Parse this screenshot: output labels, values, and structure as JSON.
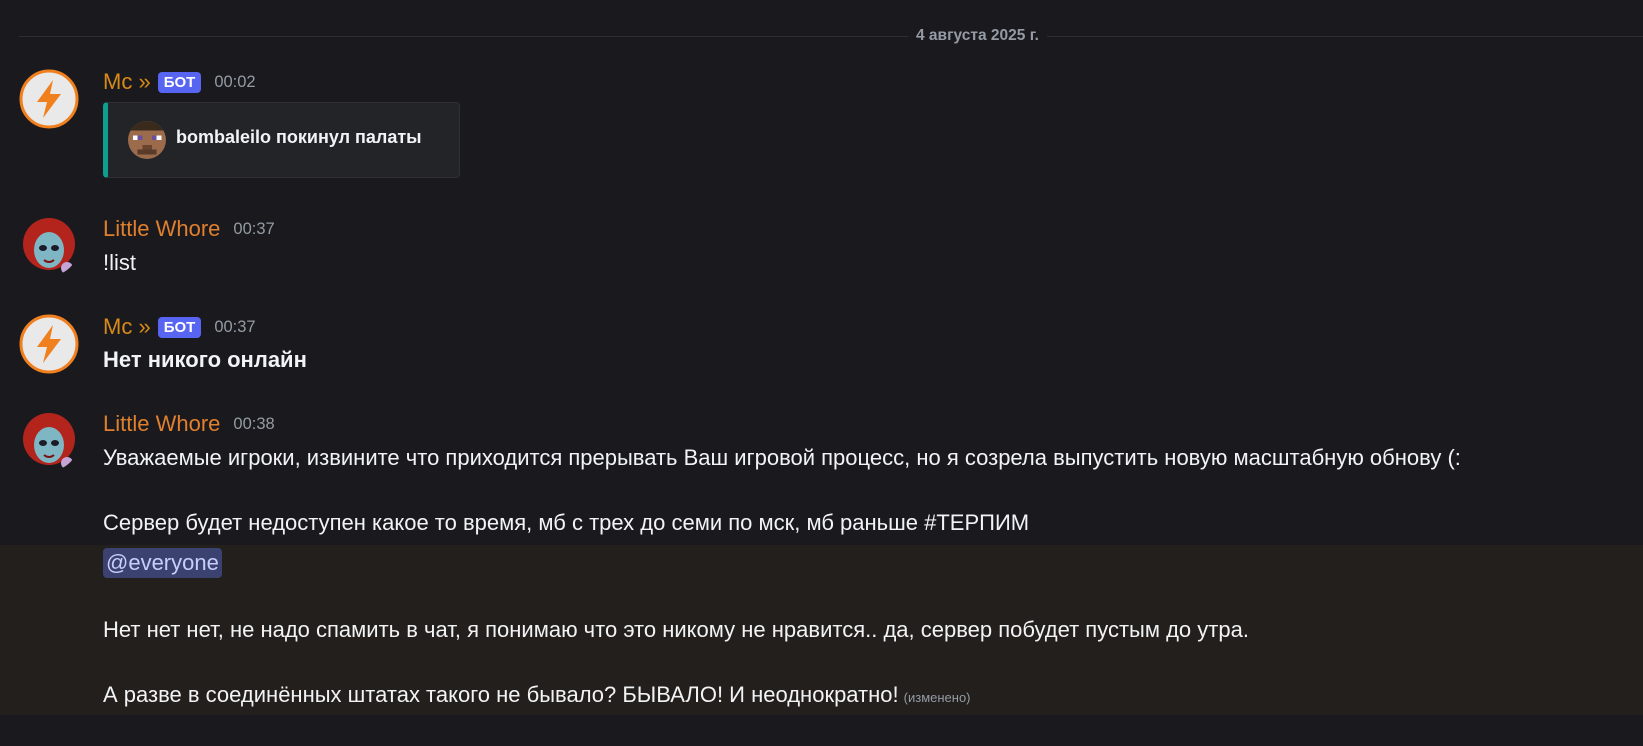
{
  "date_divider": "4 августа 2025 г.",
  "messages": [
    {
      "author": "Mc »",
      "bot_tag": "БОТ",
      "time": "00:02",
      "embed_title": "bombaleilo покинул палаты"
    },
    {
      "author": "Little Whore",
      "time": "00:37",
      "text": "!list"
    },
    {
      "author": "Mc »",
      "bot_tag": "БОТ",
      "time": "00:37",
      "text": "Нет никого онлайн"
    },
    {
      "author": "Little Whore",
      "time": "00:38",
      "line1": "Уважаемые игроки, извините что приходится прерывать Ваш игровой процесс, но я созрела выпустить новую масштабную обнову (:",
      "line2": "Сервер будет недоступен какое то время, мб с трех до семи по мск, мб раньше #ТЕРПИМ",
      "mention": "@everyone",
      "line3": "Нет нет нет, не надо спамить в чат, я понимаю что это никому не нравится.. да, сервер побудет пустым до утра.",
      "line4": "А разве в соединённых штатах такого не бывало? БЫВАЛО! И неоднократно!",
      "edited": "(изменено)"
    }
  ],
  "colors": {
    "bot_name": "#d88a17",
    "user_name": "#e07f2d",
    "bot_tag": "#5865f2",
    "embed_accent": "#0e9d8f",
    "mention_bg": "#3c4270"
  },
  "icons": {
    "bot_avatar": "lightning-bolt-icon",
    "user_avatar": "clown-face-avatar",
    "embed_thumb": "minecraft-head-icon"
  }
}
